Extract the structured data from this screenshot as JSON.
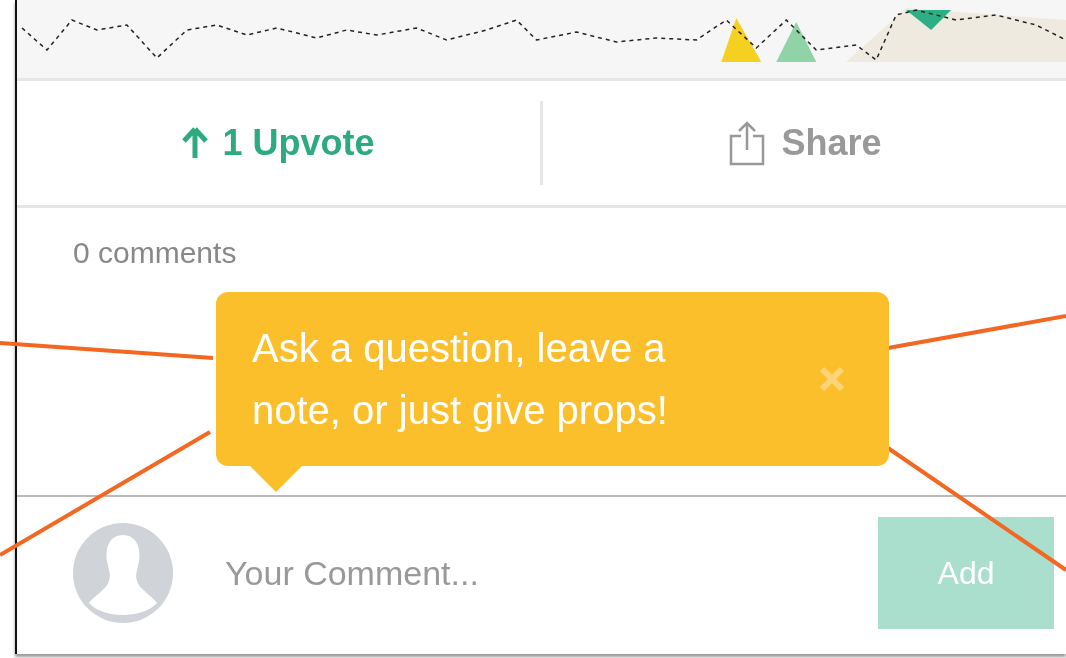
{
  "actions": [
    {
      "kind": "upvote",
      "label": "1 Upvote"
    },
    {
      "kind": "share",
      "label": "Share"
    }
  ],
  "comments_count": "0 comments",
  "tooltip": {
    "text": "Ask a question, leave a note, or just give props!"
  },
  "comment_form": {
    "placeholder": "Your Comment...",
    "button": "Add",
    "button_disabled": true
  }
}
